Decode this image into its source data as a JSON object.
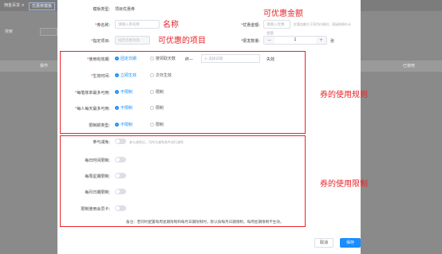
{
  "background": {
    "tabs": [
      "佣金百货 ×",
      "优惠券模板"
    ],
    "filter_label": "搜索",
    "columns": [
      "操作",
      "已使用"
    ]
  },
  "form": {
    "coupon_type": {
      "label": "模板类型:",
      "value": "项目优惠券"
    },
    "coupon_name": {
      "label": "券名称:",
      "placeholder": "请输入券名称"
    },
    "coupon_amount": {
      "label": "优惠金额:",
      "placeholder": "请输入优惠金额",
      "hint": "优惠金额大于项目价格时，直接按原价计"
    },
    "assigned_item": {
      "label": "指定项目:",
      "placeholder": "指定优惠项目"
    },
    "limit_quantity": {
      "label": "限发数量:",
      "value": "1",
      "unit": "张"
    },
    "validity": {
      "label": "使用有效期:",
      "options": [
        "固定日期",
        "按领取天数"
      ],
      "selected": 0,
      "date_prefix": "终—",
      "date_placeholder": "选择日期",
      "expire_text": "失效"
    },
    "effective_time": {
      "label": "生效时间:",
      "options": [
        "立即生效",
        "次日生效"
      ],
      "selected": 0
    },
    "per_bill_limit": {
      "label": "每笔账单最多可用:",
      "options": [
        "不限制",
        "限制"
      ],
      "selected": 0
    },
    "per_day_limit": {
      "label": "每人每天最多可用:",
      "options": [
        "不限制",
        "限制"
      ],
      "selected": 0
    },
    "limit_type": {
      "label": "限制卸类型:",
      "options": [
        "不限制",
        "限制"
      ],
      "selected": 0
    },
    "join_event": {
      "label": "参与减免:",
      "hint": "参与减免后，可作为减免条件进行减免"
    },
    "daily_time_limit": {
      "label": "每日时间限制:"
    },
    "weekly_limit": {
      "label": "每周星期限制:"
    },
    "monthly_limit": {
      "label": "每月日期限制:"
    },
    "member_limit": {
      "label": "限制使用会员卡:"
    },
    "remark": "备注：若同时配置每周星期限制和每月日期限制时，默认按每月日期限制，每周星期限制不生效。"
  },
  "buttons": {
    "cancel": "取消",
    "save": "保存"
  },
  "annotations": {
    "name": "名称",
    "amount": "可优惠金额",
    "items": "可优惠的项目",
    "rules": "券的使用规则",
    "limits": "券的使用限制"
  },
  "colors": {
    "accent": "#1a8cff",
    "annotation_red": "#e8242a"
  }
}
